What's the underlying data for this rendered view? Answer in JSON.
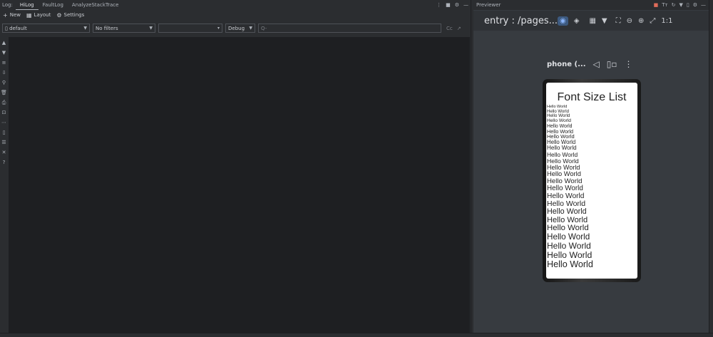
{
  "log": {
    "title": "Log:",
    "tabs": [
      "HiLog",
      "FaultLog",
      "AnalyzeStackTrace"
    ],
    "actions": [
      "⋮",
      "■",
      "⚙",
      "—"
    ],
    "toolbar": {
      "new": "New",
      "layout": "Layout",
      "settings": "Settings"
    },
    "filters": {
      "device": "default",
      "filter": "No filters",
      "process": "",
      "level": "Debug",
      "search_placeholder": "Q-",
      "tail": [
        "Cc",
        "↗"
      ]
    },
    "side_icons": [
      "▲",
      "▼",
      "≡",
      "⇩",
      "⚲",
      "🗑",
      "⎙",
      "⊡",
      "⋯",
      "▯",
      "☰",
      "✕",
      "?"
    ]
  },
  "previewer": {
    "title": "Previewer",
    "header_actions": [
      "■",
      "Tт",
      "↻",
      "▼",
      "▯",
      "⚙",
      "—"
    ],
    "entry": "entry : /pages...",
    "device_name": "phone (...",
    "toolbar_icons": [
      "layers-icon",
      "grid-icon",
      "frame-icon",
      "zoom-out-icon",
      "zoom-in-icon",
      "fit-icon"
    ],
    "ratio": "1:1",
    "app": {
      "title": "Font Size List",
      "items": [
        {
          "text": "Hello World",
          "size": 5.5
        },
        {
          "text": "Hello World",
          "size": 6
        },
        {
          "text": "Hello World",
          "size": 6.3
        },
        {
          "text": "Hello World",
          "size": 6.6
        },
        {
          "text": "Hello World",
          "size": 6.9
        },
        {
          "text": "Hello World",
          "size": 7.2
        },
        {
          "text": "Hello World",
          "size": 7.5
        },
        {
          "text": "Hello World",
          "size": 7.8
        },
        {
          "text": "Hello World",
          "size": 8.1
        },
        {
          "text": "Hello World",
          "size": 8.4
        },
        {
          "text": "Hello World",
          "size": 8.7
        },
        {
          "text": "Hello World",
          "size": 9
        },
        {
          "text": "Hello World",
          "size": 9.3
        },
        {
          "text": "Hello World",
          "size": 9.6
        },
        {
          "text": "Hello World",
          "size": 9.9
        },
        {
          "text": "Hello World",
          "size": 10.2
        },
        {
          "text": "Hello World",
          "size": 10.5
        },
        {
          "text": "Hello World",
          "size": 10.8
        },
        {
          "text": "Hello World",
          "size": 11.1
        },
        {
          "text": "Hello World",
          "size": 11.4
        },
        {
          "text": "Hello World",
          "size": 11.7
        },
        {
          "text": "Hello World",
          "size": 12
        },
        {
          "text": "Hello World",
          "size": 12.3
        },
        {
          "text": "Hello World",
          "size": 12.6
        }
      ]
    }
  }
}
